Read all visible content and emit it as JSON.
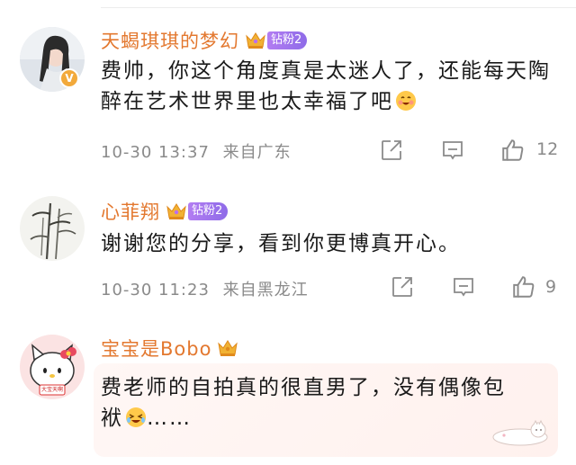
{
  "comments": [
    {
      "username": "天蝎琪琪的梦幻",
      "fan_badge": "钻粉2",
      "text": "费帅，你这个角度真是太迷人了，还能每天陶醉在艺术世界里也太幸福了吧",
      "emoji": "happy-face-emoji",
      "time": "10-30 13:37",
      "location": "来自广东",
      "likes": "12",
      "verified": true
    },
    {
      "username": "心菲翔",
      "fan_badge": "钻粉2",
      "text": "谢谢您的分享，看到你更博真开心。",
      "time": "10-30 11:23",
      "location": "来自黑龙江",
      "likes": "9"
    },
    {
      "username": "宝宝是Bobo",
      "text_line1": "费老师的自拍真的很直男了，没有偶像包",
      "text_line2_pre": "袱",
      "text_line2_post": "……",
      "emoji": "laughing-face-emoji"
    }
  ],
  "avatar_labels": {
    "bobo_tag": "大宝天啊"
  },
  "icons": [
    "crown-icon",
    "share-icon",
    "comment-icon",
    "like-icon",
    "verified-icon"
  ],
  "colors": {
    "username": "#e3782f",
    "fan_badge": "#9b72ec",
    "meta": "#8a8a8a",
    "verified": "#f2a93b"
  }
}
